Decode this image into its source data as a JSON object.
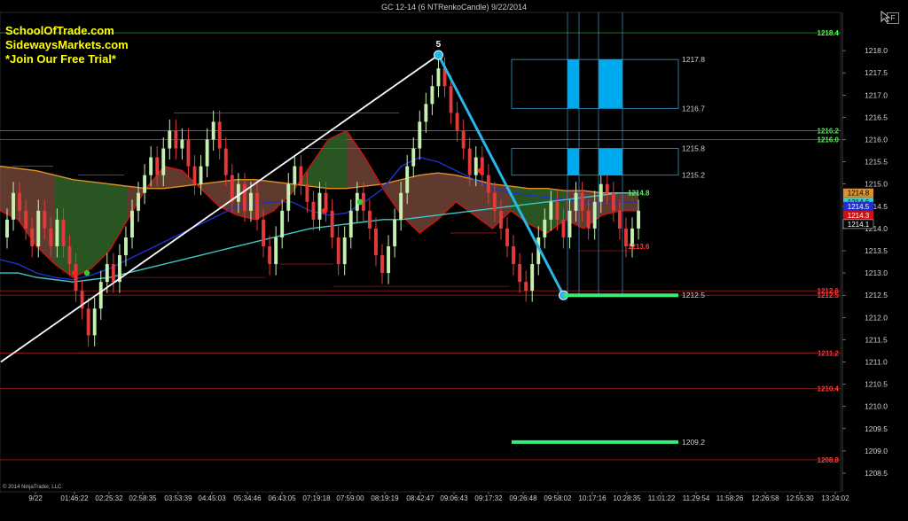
{
  "header": {
    "title": "GC 12-14 (6 NTRenkoCandle)  9/22/2014",
    "promo_lines": [
      "SchoolOfTrade.com",
      "SidewaysMarkets.com",
      "*Join Our Free Trial*"
    ],
    "copyright": "© 2014 NinjaTrader, LLC",
    "f_button": "F"
  },
  "colors": {
    "background": "#000000",
    "bull": "#c6f0b0",
    "bear": "#e23a3a",
    "zone_box": "#3399cc",
    "zone_fill": "#00aaee",
    "trend_line": "#29b6e8",
    "target_line": "#33ee77",
    "ema_cyan": "#3fc8c8",
    "ema_blue": "#2030d0",
    "ema_orange": "#e0902a",
    "ema_red": "#d01010"
  },
  "chart_data": {
    "type": "candlestick",
    "symbol": "GC 12-14",
    "bar_type": "6 NTRenkoCandle",
    "date": "9/22/2014",
    "ylim": [
      1208.2,
      1218.7
    ],
    "y_ticks": [
      1208.5,
      1209.0,
      1209.5,
      1210.0,
      1210.5,
      1211.0,
      1211.5,
      1212.0,
      1212.5,
      1213.0,
      1213.5,
      1214.0,
      1214.5,
      1215.0,
      1215.5,
      1216.0,
      1216.5,
      1217.0,
      1217.5,
      1218.0
    ],
    "x_tick_labels": [
      "9/22",
      "01:46:22",
      "02:25:32",
      "02:58:35",
      "03:53:39",
      "04:45:03",
      "05:34:46",
      "06:43:05",
      "07:19:18",
      "07:59:00",
      "08:19:19",
      "08:42:47",
      "09:06:43",
      "09:17:32",
      "09:26:48",
      "09:58:02",
      "10:17:16",
      "10:28:35",
      "11:01:22",
      "11:29:54",
      "11:58:26",
      "12:26:58",
      "12:55:30",
      "13:24:02"
    ],
    "closes": [
      1214.2,
      1214.8,
      1214.4,
      1214.0,
      1213.6,
      1214.4,
      1214.0,
      1213.6,
      1214.2,
      1213.6,
      1213.2,
      1212.6,
      1212.2,
      1211.6,
      1212.2,
      1212.8,
      1213.2,
      1212.8,
      1213.4,
      1213.8,
      1214.4,
      1214.8,
      1215.2,
      1215.6,
      1215.2,
      1215.8,
      1216.2,
      1215.8,
      1216.0,
      1215.4,
      1215.0,
      1215.4,
      1216.0,
      1216.4,
      1215.8,
      1215.2,
      1214.6,
      1215.0,
      1214.4,
      1214.8,
      1214.2,
      1213.6,
      1213.2,
      1213.8,
      1214.4,
      1215.0,
      1215.4,
      1215.0,
      1214.6,
      1214.2,
      1214.8,
      1214.4,
      1213.8,
      1213.2,
      1213.8,
      1214.4,
      1214.8,
      1214.4,
      1214.0,
      1213.4,
      1213.0,
      1213.6,
      1214.2,
      1214.8,
      1215.4,
      1215.8,
      1216.4,
      1216.8,
      1217.2,
      1217.6,
      1217.2,
      1216.6,
      1216.2,
      1215.8,
      1215.2,
      1215.6,
      1215.2,
      1214.8,
      1214.4,
      1214.0,
      1213.6,
      1213.2,
      1212.8,
      1212.6,
      1213.2,
      1213.8,
      1214.2,
      1214.6,
      1214.2,
      1213.8,
      1214.4,
      1214.8,
      1214.4,
      1214.0,
      1214.6,
      1215.0,
      1214.8,
      1214.4,
      1214.0,
      1213.6,
      1214.0,
      1214.4
    ],
    "ema_cyan": [
      1213.0,
      1213.0,
      1212.9,
      1212.85,
      1212.8,
      1212.85,
      1212.9,
      1213.0,
      1213.1,
      1213.2,
      1213.3,
      1213.4,
      1213.5,
      1213.6,
      1213.7,
      1213.8,
      1213.9,
      1214.0,
      1214.05,
      1214.1,
      1214.15,
      1214.2,
      1214.2,
      1214.25,
      1214.3,
      1214.35,
      1214.4,
      1214.45,
      1214.5,
      1214.55,
      1214.6,
      1214.65,
      1214.7,
      1214.75,
      1214.8,
      1214.8
    ],
    "ema_blue": [
      1213.3,
      1213.2,
      1213.0,
      1212.9,
      1212.85,
      1212.95,
      1213.1,
      1213.3,
      1213.5,
      1213.7,
      1213.9,
      1214.1,
      1214.3,
      1214.5,
      1214.55,
      1214.6,
      1214.6,
      1214.4,
      1214.3,
      1214.35,
      1214.6,
      1214.9,
      1215.4,
      1215.6,
      1215.5,
      1215.3,
      1215.1,
      1214.9,
      1214.8,
      1214.75,
      1214.7,
      1214.65,
      1214.6,
      1214.6,
      1214.6,
      1214.6
    ],
    "ema_orange": [
      1215.4,
      1215.35,
      1215.3,
      1215.2,
      1215.1,
      1215.05,
      1215.0,
      1214.95,
      1214.9,
      1214.9,
      1214.95,
      1215.0,
      1215.05,
      1215.1,
      1215.1,
      1215.05,
      1215.0,
      1214.95,
      1214.9,
      1214.9,
      1214.95,
      1215.0,
      1215.1,
      1215.2,
      1215.25,
      1215.2,
      1215.1,
      1215.0,
      1214.95,
      1214.9,
      1214.9,
      1214.85,
      1214.85,
      1214.8,
      1214.8,
      1214.8
    ],
    "ema_red": [
      1214.4,
      1214.2,
      1213.6,
      1213.2,
      1212.9,
      1213.1,
      1213.5,
      1214.2,
      1214.9,
      1215.4,
      1215.3,
      1214.9,
      1214.5,
      1214.3,
      1214.2,
      1214.4,
      1214.8,
      1215.4,
      1216.0,
      1216.2,
      1215.6,
      1214.9,
      1214.3,
      1213.9,
      1214.2,
      1214.6,
      1214.3,
      1214.0,
      1214.4,
      1214.1,
      1213.9,
      1214.2,
      1214.0,
      1214.3,
      1214.4,
      1214.4
    ],
    "wave_label": "5",
    "wave_line": [
      {
        "bar": -1,
        "price": 1211.0
      },
      {
        "bar": 69,
        "price": 1217.9
      }
    ],
    "trend_line": [
      {
        "bar": 69,
        "price": 1217.9
      },
      {
        "bar": 89,
        "price": 1212.5
      }
    ],
    "zones": [
      {
        "high": 1217.8,
        "low": 1216.7,
        "high_label": "1217.8",
        "low_label": "1216.7"
      },
      {
        "high": 1215.8,
        "low": 1215.2,
        "high_label": "1215.8",
        "low_label": "1215.2"
      }
    ],
    "targets": [
      {
        "price": 1212.5,
        "label": "1212.5"
      },
      {
        "price": 1209.2,
        "label": "1209.2"
      }
    ],
    "horizontal_lines": [
      {
        "price": 1218.4,
        "color": "green",
        "label": "1218.4"
      },
      {
        "price": 1216.2,
        "color": "green",
        "label": "1216.2"
      },
      {
        "price": 1216.0,
        "color": "green",
        "label": "1216.0"
      },
      {
        "price": 1212.6,
        "color": "red",
        "label": "1212.6"
      },
      {
        "price": 1212.5,
        "color": "red",
        "label": "1212.5"
      },
      {
        "price": 1211.2,
        "color": "red",
        "label": "1211.2"
      },
      {
        "price": 1210.4,
        "color": "red",
        "label": "1210.4"
      },
      {
        "price": 1208.8,
        "color": "red",
        "label": "1208.8"
      }
    ],
    "inline_labels": [
      {
        "price": 1214.8,
        "text": "1214.8",
        "color": "green"
      },
      {
        "price": 1213.6,
        "text": "1213.6",
        "color": "red"
      }
    ],
    "price_markers": [
      {
        "price": 1214.8,
        "text": "1214.8",
        "bg": "#e0902a"
      },
      {
        "price": 1214.6,
        "text": "1214.6",
        "bg": "#3fc8c8"
      },
      {
        "price": 1214.5,
        "text": "1214.5",
        "bg": "#2030d0"
      },
      {
        "price": 1214.3,
        "text": "1214.3",
        "bg": "#d01010"
      },
      {
        "price": 1214.1,
        "text": "1214.1",
        "bg": "#000000"
      }
    ]
  }
}
